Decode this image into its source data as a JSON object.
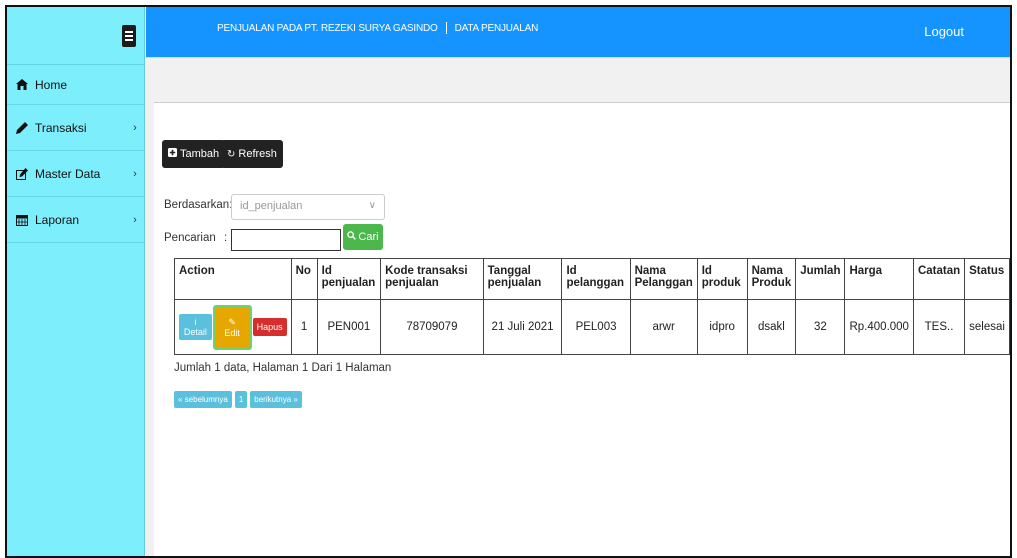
{
  "header": {
    "title": "PENJUALAN PADA PT. REZEKI SURYA GASINDO",
    "section": "DATA PENJUALAN",
    "logout_label": "Logout"
  },
  "sidebar": {
    "items": [
      {
        "label": "Home",
        "icon": "home-icon"
      },
      {
        "label": "Transaksi",
        "icon": "pencil-icon"
      },
      {
        "label": "Master Data",
        "icon": "edit-square-icon"
      },
      {
        "label": "Laporan",
        "icon": "calendar-icon"
      }
    ]
  },
  "toolbar": {
    "tambah_label": "Tambah",
    "refresh_label": "Refresh"
  },
  "filter": {
    "berdasarkan_label": "Berdasarkan:",
    "select_value": "id_penjualan",
    "pencarian_label": "Pencarian",
    "pencarian_colon": ":",
    "search_value": "",
    "cari_label": "Cari"
  },
  "table": {
    "headers": [
      "Action",
      "No",
      "Id penjualan",
      "Kode transaksi penjualan",
      "Tanggal penjualan",
      "Id pelanggan",
      "Nama Pelanggan",
      "Id produk",
      "Nama Produk",
      "Jumlah",
      "Harga",
      "Catatan",
      "Status"
    ],
    "row_actions": {
      "detail": "Detail",
      "edit": "Edit",
      "hapus": "Hapus"
    },
    "rows": [
      {
        "no": "1",
        "id_penjualan": "PEN001",
        "kode": "78709079",
        "tanggal": "21 Juli 2021",
        "id_pelanggan": "PEL003",
        "nama_pelanggan": "arwr",
        "id_produk": "idpro",
        "nama_produk": "dsakl",
        "jumlah": "32",
        "harga": "Rp.400.000",
        "catatan": "TES..",
        "status": "selesai"
      }
    ]
  },
  "summary": "Jumlah 1 data, Halaman 1 Dari 1 Halaman",
  "pagination": {
    "prev": "« sebelumnya",
    "page": "1",
    "next": "berikutnya »"
  },
  "colors": {
    "sidebar": "#7deefc",
    "topbar": "#1594ff",
    "cari": "#4cb84c",
    "detail": "#5bc0de",
    "edit": "#e6a800",
    "hapus": "#d62d2d"
  }
}
